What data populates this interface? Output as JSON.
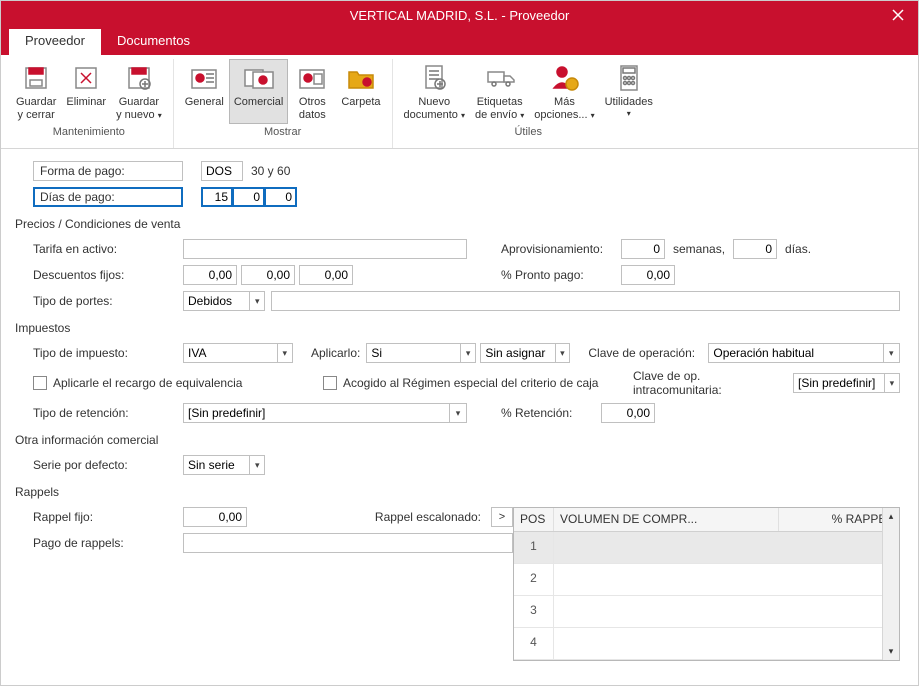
{
  "window": {
    "title": "VERTICAL MADRID, S.L. - Proveedor"
  },
  "tabs": {
    "proveedor": "Proveedor",
    "documentos": "Documentos"
  },
  "ribbon": {
    "mantenimiento": {
      "label": "Mantenimiento",
      "guardar_cerrar_1": "Guardar",
      "guardar_cerrar_2": "y cerrar",
      "eliminar": "Eliminar",
      "guardar_nuevo_1": "Guardar",
      "guardar_nuevo_2": "y nuevo"
    },
    "mostrar": {
      "label": "Mostrar",
      "general": "General",
      "comercial": "Comercial",
      "otros_1": "Otros",
      "otros_2": "datos",
      "carpeta": "Carpeta"
    },
    "utiles": {
      "label": "Útiles",
      "nuevo_1": "Nuevo",
      "nuevo_2": "documento",
      "etiquetas_1": "Etiquetas",
      "etiquetas_2": "de envío",
      "mas_1": "Más",
      "mas_2": "opciones...",
      "utilidades": "Utilidades"
    }
  },
  "header_rows": {
    "forma_pago_label": "Forma de pago:",
    "forma_pago_code": "DOS",
    "forma_pago_desc": "30 y 60",
    "dias_pago_label": "Días de pago:",
    "dias_pago_1": "15",
    "dias_pago_2": "0",
    "dias_pago_3": "0"
  },
  "precios": {
    "title": "Precios / Condiciones de venta",
    "tarifa_label": "Tarifa en activo:",
    "tarifa_value": "",
    "aprovisionamiento_label": "Aprovisionamiento:",
    "aprov_semanas": "0",
    "semanas_text": "semanas,",
    "aprov_dias": "0",
    "dias_text": "días.",
    "descuentos_label": "Descuentos fijos:",
    "desc_1": "0,00",
    "desc_2": "0,00",
    "desc_3": "0,00",
    "pronto_label": "% Pronto pago:",
    "pronto_val": "0,00",
    "portes_label": "Tipo de portes:",
    "portes_val": "Debidos",
    "portes_extra": ""
  },
  "impuestos": {
    "title": "Impuestos",
    "tipo_impuesto_label": "Tipo de impuesto:",
    "tipo_impuesto_val": "IVA",
    "aplicarlo_label": "Aplicarlo:",
    "aplicarlo_val": "Si",
    "sin_asignar": "Sin asignar",
    "clave_op_label": "Clave de operación:",
    "clave_op_val": "Operación habitual",
    "recargo_label": "Aplicarle el recargo de equivalencia",
    "acogido_label": "Acogido al Régimen especial del criterio de caja",
    "clave_intra_label": "Clave de op. intracomunitaria:",
    "clave_intra_val": "[Sin predefinir]",
    "retencion_label": "Tipo de retención:",
    "retencion_val": "[Sin predefinir]",
    "pct_ret_label": "% Retención:",
    "pct_ret_val": "0,00"
  },
  "otra": {
    "title": "Otra información comercial",
    "serie_label": "Serie por defecto:",
    "serie_val": "Sin serie"
  },
  "rappels": {
    "title": "Rappels",
    "fijo_label": "Rappel fijo:",
    "fijo_val": "0,00",
    "escalonado_label": "Rappel escalonado:",
    "pago_label": "Pago de rappels:",
    "pago_val": "",
    "col_pos": "POS",
    "col_vol": "VOLUMEN DE COMPR...",
    "col_pct": "% RAPPEL",
    "rows": [
      "1",
      "2",
      "3",
      "4"
    ]
  }
}
